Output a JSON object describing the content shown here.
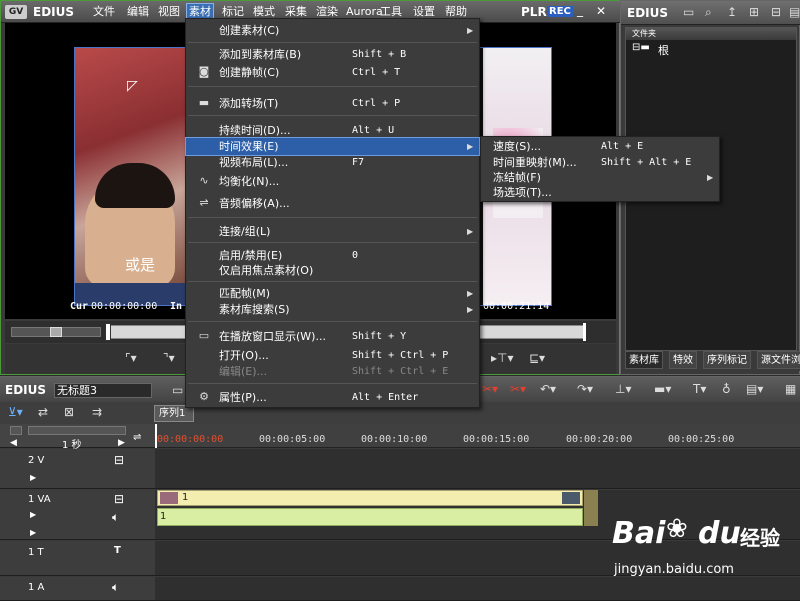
{
  "player": {
    "app_name": "EDIUS",
    "menus": [
      "文件",
      "编辑",
      "视图",
      "素材",
      "标记",
      "模式",
      "采集",
      "渲染",
      "Aurora",
      "工具",
      "设置",
      "帮助"
    ],
    "mode": "PLR",
    "rec": "REC",
    "close": "✕",
    "minimize": "_",
    "subtitle": "或是",
    "cur_label": "Cur",
    "cur_tc": "00:00:00:00",
    "in_label": "In",
    "out_tc": "00:00:21:14"
  },
  "bin": {
    "app_name": "EDIUS",
    "folder_header": "文件夹",
    "root": "根",
    "tabs": [
      "素材库",
      "特效",
      "序列标记",
      "源文件浏"
    ]
  },
  "timeline": {
    "app_name": "EDIUS",
    "project": "无标题3",
    "sequence_tab": "序列1",
    "zoom": "1 秒",
    "ruler": [
      "00:00:00:00",
      "00:00:05:00",
      "00:00:10:00",
      "00:00:15:00",
      "00:00:20:00",
      "00:00:25:00"
    ],
    "tracks": [
      {
        "name": "2 V"
      },
      {
        "name": "1 VA",
        "clip_video": "1",
        "clip_audio": "1"
      },
      {
        "name": "1 T"
      },
      {
        "name": "1 A"
      }
    ]
  },
  "menu": {
    "items": [
      {
        "label": "创建素材(C)",
        "shortcut": "",
        "arrow": "▶"
      },
      {
        "label": "添加到素材库(B)",
        "shortcut": "Shift + B"
      },
      {
        "label": "创建静帧(C)",
        "shortcut": "Ctrl + T",
        "icon": "camera"
      },
      {
        "label": "添加转场(T)",
        "shortcut": "Ctrl + P",
        "icon": "transition"
      },
      {
        "label": "持续时间(D)...",
        "shortcut": "Alt + U"
      },
      {
        "label": "时间效果(E)",
        "shortcut": "",
        "arrow": "▶"
      },
      {
        "label": "视频布局(L)...",
        "shortcut": "F7"
      },
      {
        "label": "均衡化(N)...",
        "shortcut": "",
        "icon": "eq"
      },
      {
        "label": "音频偏移(A)...",
        "shortcut": "",
        "icon": "audio"
      },
      {
        "label": "连接/组(L)",
        "shortcut": "",
        "arrow": "▶"
      },
      {
        "label": "启用/禁用(E)",
        "shortcut": "0"
      },
      {
        "label": "仅启用焦点素材(O)",
        "shortcut": ""
      },
      {
        "label": "匹配帧(M)",
        "shortcut": "",
        "arrow": "▶"
      },
      {
        "label": "素材库搜索(S)",
        "shortcut": "",
        "arrow": "▶"
      },
      {
        "label": "在播放窗口显示(W)...",
        "shortcut": "Shift + Y",
        "icon": "monitor"
      },
      {
        "label": "打开(O)...",
        "shortcut": "Shift + Ctrl + P"
      },
      {
        "label": "编辑(E)...",
        "shortcut": "Shift + Ctrl + E"
      },
      {
        "label": "属性(P)...",
        "shortcut": "Alt + Enter",
        "icon": "props"
      }
    ],
    "submenu": [
      {
        "label": "速度(S)...",
        "shortcut": "Alt + E"
      },
      {
        "label": "时间重映射(M)...",
        "shortcut": "Shift + Alt + E"
      },
      {
        "label": "冻结帧(F)",
        "shortcut": "",
        "arrow": "▶"
      },
      {
        "label": "场选项(T)...",
        "shortcut": ""
      }
    ]
  },
  "watermark": {
    "brand": "Bai",
    "brand2": "du",
    "suffix": "经验",
    "url": "jingyan.baidu.com"
  }
}
